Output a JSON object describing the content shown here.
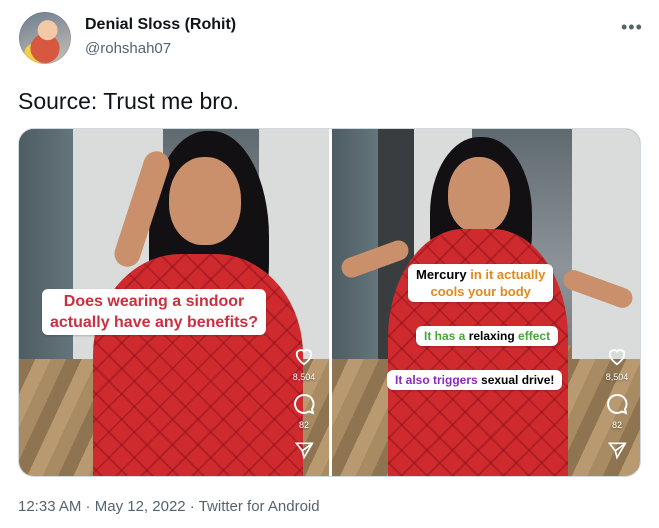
{
  "author": {
    "display_name": "Denial Sloss (Rohit)",
    "handle": "@rohshah07",
    "avatar_icon": "profile-photo"
  },
  "more_icon": "more-icon",
  "tweet_text": "Source: Trust me bro.",
  "media": {
    "left": {
      "caption_line1": "Does wearing a sindoor",
      "caption_line2": "actually have any benefits?",
      "likes": "8,504",
      "comments": "82"
    },
    "right": {
      "caption_mercury_a": "Mercury ",
      "caption_mercury_b": "in it actually",
      "caption_mercury_c": "cools your body",
      "caption_relax_a": "It has a ",
      "caption_relax_b": "relaxing",
      "caption_relax_c": " effect",
      "caption_trig_a": "It also triggers ",
      "caption_trig_b": "sexual drive!",
      "likes": "8,504",
      "comments": "82"
    }
  },
  "meta": {
    "time": "12:33 AM",
    "separator": " · ",
    "date": "May 12, 2022",
    "source": "Twitter for Android"
  },
  "colors": {
    "accent_red": "#cc2f3f",
    "orange": "#e08a1e",
    "green": "#4aa63a",
    "purple": "#8a2bb8",
    "secondary_text": "#536471"
  }
}
